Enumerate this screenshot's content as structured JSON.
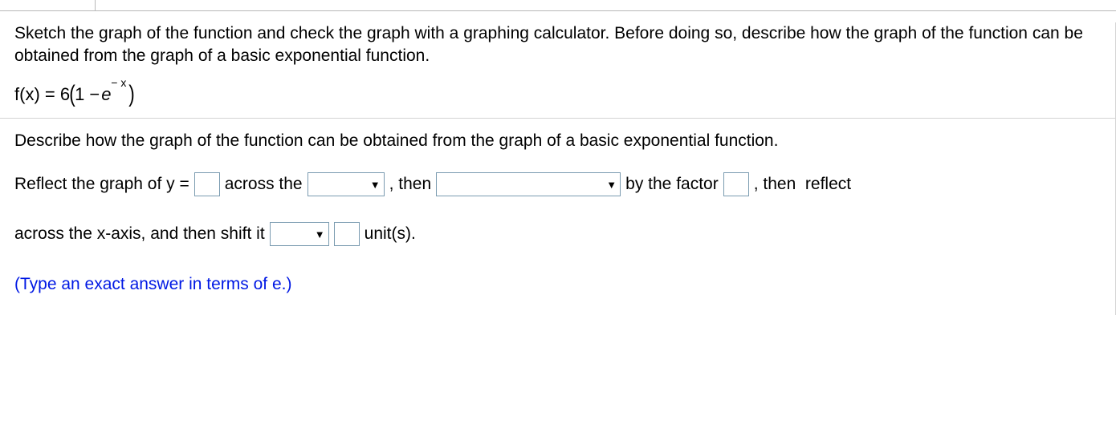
{
  "question": {
    "prompt": "Sketch the graph of the function and check the graph with a graphing calculator. Before doing so, describe how the graph of the function can be obtained from the graph of a basic exponential function.",
    "equation": {
      "lhs": "f(x) = 6",
      "paren_open": "(",
      "inner_pre": "1 − ",
      "base": "e",
      "exponent": "− x",
      "paren_close": ")"
    }
  },
  "subquestion": {
    "prompt": "Describe how the graph of the function can be obtained from the graph of a basic exponential function.",
    "parts": {
      "t1": "Reflect the graph of y =",
      "t2": "across the",
      "t3": ", then",
      "t4": "by the factor",
      "t5": ", then  reflect",
      "t6": "across the x-axis, and then shift it",
      "t7": "unit(s)."
    },
    "hint": "(Type an exact answer in terms of e.)"
  }
}
